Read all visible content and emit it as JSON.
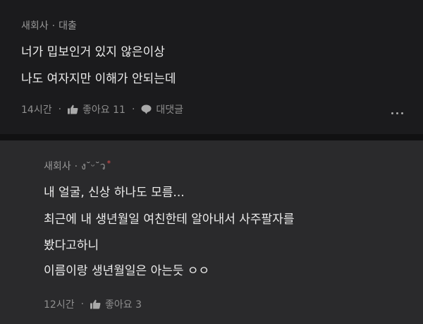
{
  "comment1": {
    "author": "새회사",
    "author_extra": "대출",
    "lines": [
      "너가 밉보인거 있지 않은이상",
      "나도 여자지만 이해가 안되는데"
    ],
    "time": "14시간",
    "like_label": "좋아요 11",
    "reply_label": "대댓글"
  },
  "comment2": {
    "author": "새회사",
    "author_extra": "ง˘ᵕ˘ว",
    "lines": [
      "내 얼굴, 신상 하나도 모름...",
      "최근에 내 생년월일 여친한테 알아내서 사주팔자를",
      "봤다고하니",
      "이름이랑 생년월일은 아는듯 ㅇㅇ"
    ],
    "time": "12시간",
    "like_label": "좋아요 3"
  },
  "icons": {
    "like": "thumbs-up-icon",
    "reply": "speech-bubble-icon",
    "more": "more-dots-icon"
  }
}
